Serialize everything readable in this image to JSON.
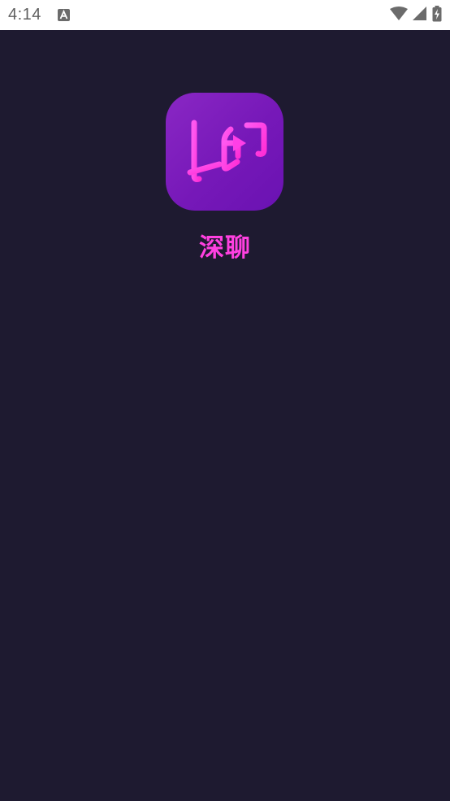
{
  "status_bar": {
    "time": "4:14",
    "icons": [
      "notification-a-icon",
      "wifi-icon",
      "cell-signal-icon",
      "battery-charging-icon"
    ]
  },
  "splash": {
    "app_name": "深聊",
    "logo_glyph": "聊",
    "colors": {
      "background": "#1e1a30",
      "icon_gradient_start": "#8a27c4",
      "icon_gradient_end": "#6a12b2",
      "accent": "#ff40e0"
    }
  }
}
